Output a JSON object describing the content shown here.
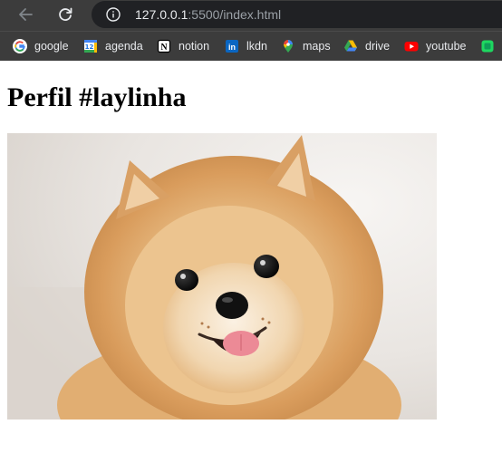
{
  "browser": {
    "url_host": "127.0.0.1",
    "url_rest": ":5500/index.html"
  },
  "bookmarks": [
    {
      "label": "google",
      "icon": "google-icon"
    },
    {
      "label": "agenda",
      "icon": "calendar-icon",
      "badge": "12"
    },
    {
      "label": "notion",
      "icon": "notion-icon",
      "badge": "N"
    },
    {
      "label": "lkdn",
      "icon": "linkedin-icon",
      "badge": "in"
    },
    {
      "label": "maps",
      "icon": "maps-pin-icon"
    },
    {
      "label": "drive",
      "icon": "drive-icon"
    },
    {
      "label": "youtube",
      "icon": "youtube-icon"
    },
    {
      "label": "",
      "icon": "green-app-icon"
    }
  ],
  "page": {
    "title": "Perfil #laylinha",
    "image_subject": "pomeranian-dog-photo"
  },
  "colors": {
    "chrome_bg": "#3c3c3c",
    "omnibox_bg": "#202124",
    "url_host": "#e8eaed",
    "url_rest": "#9aa0a6",
    "page_bg": "#ffffff"
  }
}
